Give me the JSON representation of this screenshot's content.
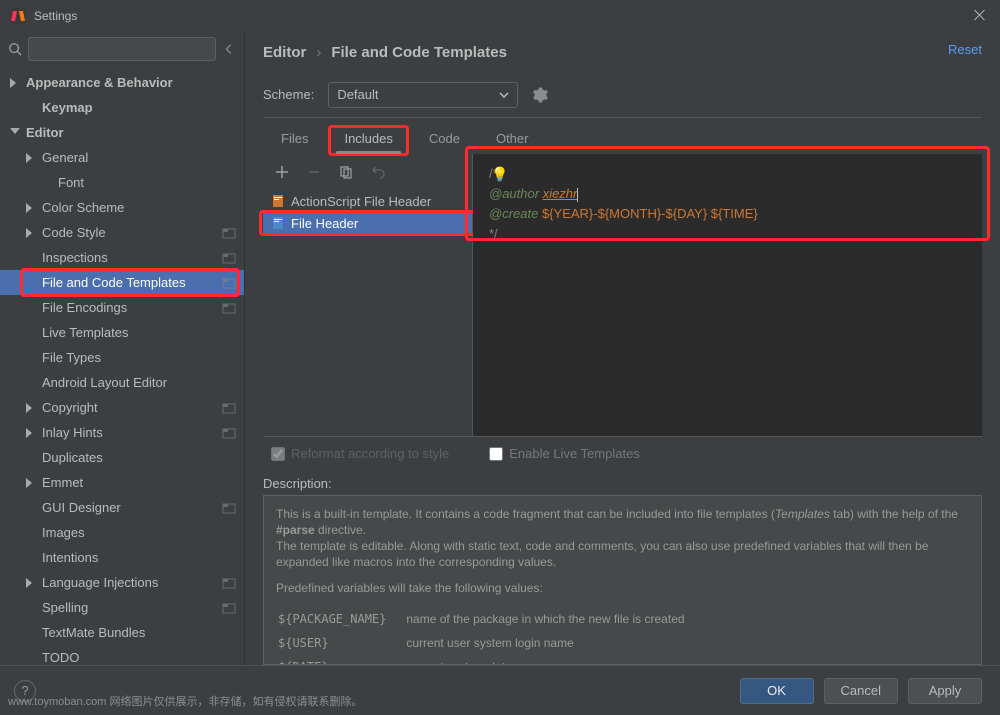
{
  "window": {
    "title": "Settings"
  },
  "sidebar": {
    "items": [
      {
        "label": "Appearance & Behavior",
        "depth": 0,
        "arrow": "right",
        "bold": true
      },
      {
        "label": "Keymap",
        "depth": 1,
        "arrow": "none",
        "bold": true
      },
      {
        "label": "Editor",
        "depth": 0,
        "arrow": "down",
        "bold": true
      },
      {
        "label": "General",
        "depth": 1,
        "arrow": "right"
      },
      {
        "label": "Font",
        "depth": 2,
        "arrow": "none"
      },
      {
        "label": "Color Scheme",
        "depth": 1,
        "arrow": "right"
      },
      {
        "label": "Code Style",
        "depth": 1,
        "arrow": "right",
        "proj": true
      },
      {
        "label": "Inspections",
        "depth": 1,
        "arrow": "none",
        "proj": true
      },
      {
        "label": "File and Code Templates",
        "depth": 1,
        "arrow": "none",
        "selected": true,
        "proj": true,
        "highlight": true
      },
      {
        "label": "File Encodings",
        "depth": 1,
        "arrow": "none",
        "proj": true
      },
      {
        "label": "Live Templates",
        "depth": 1,
        "arrow": "none"
      },
      {
        "label": "File Types",
        "depth": 1,
        "arrow": "none"
      },
      {
        "label": "Android Layout Editor",
        "depth": 1,
        "arrow": "none"
      },
      {
        "label": "Copyright",
        "depth": 1,
        "arrow": "right",
        "proj": true
      },
      {
        "label": "Inlay Hints",
        "depth": 1,
        "arrow": "right",
        "proj": true
      },
      {
        "label": "Duplicates",
        "depth": 1,
        "arrow": "none"
      },
      {
        "label": "Emmet",
        "depth": 1,
        "arrow": "right"
      },
      {
        "label": "GUI Designer",
        "depth": 1,
        "arrow": "none",
        "proj": true
      },
      {
        "label": "Images",
        "depth": 1,
        "arrow": "none"
      },
      {
        "label": "Intentions",
        "depth": 1,
        "arrow": "none"
      },
      {
        "label": "Language Injections",
        "depth": 1,
        "arrow": "right",
        "proj": true
      },
      {
        "label": "Spelling",
        "depth": 1,
        "arrow": "none",
        "proj": true
      },
      {
        "label": "TextMate Bundles",
        "depth": 1,
        "arrow": "none"
      },
      {
        "label": "TODO",
        "depth": 1,
        "arrow": "none"
      }
    ]
  },
  "breadcrumb": {
    "a": "Editor",
    "b": "File and Code Templates"
  },
  "reset_label": "Reset",
  "scheme": {
    "label": "Scheme:",
    "value": "Default"
  },
  "tabs": [
    {
      "label": "Files"
    },
    {
      "label": "Includes",
      "active": true,
      "highlight": true
    },
    {
      "label": "Code"
    },
    {
      "label": "Other"
    }
  ],
  "templates": [
    {
      "label": "ActionScript File Header",
      "icon": "orange"
    },
    {
      "label": "File Header",
      "selected": true,
      "icon": "blue",
      "highlight": true
    }
  ],
  "editor": {
    "l1_open": "/*",
    "l2_kw": "@author",
    "l2_val": "xiezhr",
    "l3_kw": "@create",
    "l3_macro": "${YEAR}-${MONTH}-${DAY} ${TIME}",
    "l4_close": "*/"
  },
  "options": {
    "reformat": "Reformat according to style",
    "enable_live": "Enable Live Templates"
  },
  "description": {
    "heading": "Description:",
    "p1a": "This is a built-in template. It contains a code fragment that can be included into file templates (",
    "p1i": "Templates",
    "p1b": " tab) with the help of the ",
    "p1d": "#parse",
    "p1c": " directive.",
    "p2": "The template is editable. Along with static text, code and comments, you can also use predefined variables that will then be expanded like macros into the corresponding values.",
    "p3": "Predefined variables will take the following values:",
    "vars": [
      {
        "name": "${PACKAGE_NAME}",
        "desc": "name of the package in which the new file is created"
      },
      {
        "name": "${USER}",
        "desc": "current user system login name"
      },
      {
        "name": "${DATE}",
        "desc": "current system date"
      }
    ]
  },
  "footer": {
    "ok": "OK",
    "cancel": "Cancel",
    "apply": "Apply"
  },
  "watermark": "www.toymoban.com  网络图片仅供展示，非存储，如有侵权请联系删除。"
}
